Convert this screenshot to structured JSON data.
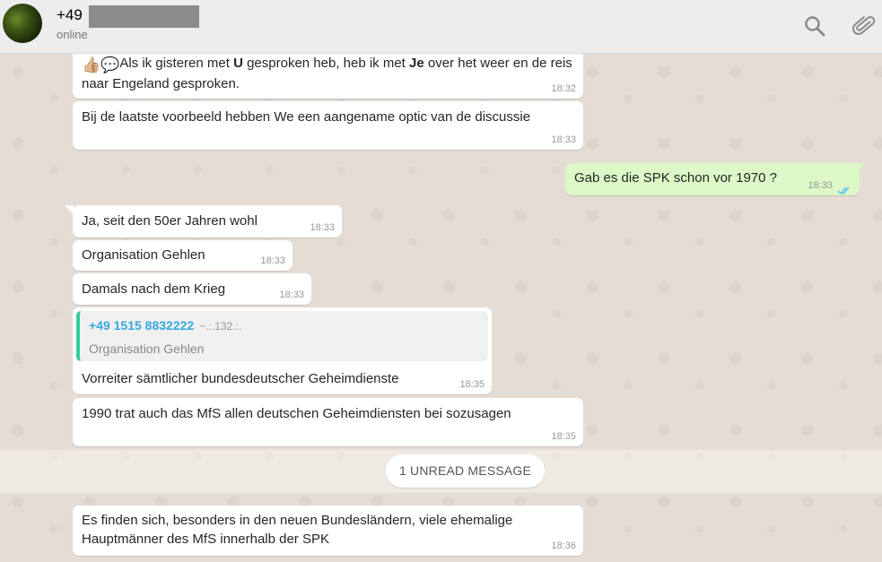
{
  "header": {
    "contact_name": "+49",
    "status": "online",
    "search_icon": "search-icon",
    "attach_icon": "paperclip-icon"
  },
  "messages": [
    {
      "dir": "in",
      "emoji": "👍🏼💬",
      "text": "Als ik gisteren met U gesproken heb, heb ik met Je over het weer en de reis naar Engeland gesproken.",
      "time": "18:32"
    },
    {
      "dir": "in",
      "text": "Bij de laatste voorbeeld hebben We een aangename optic van de discussie",
      "time": "18:33"
    },
    {
      "dir": "out",
      "text": "Gab es die SPK schon vor 1970 ?",
      "time": "18:33",
      "status": "read"
    },
    {
      "dir": "in",
      "text": "Ja, seit den 50er Jahren wohl",
      "time": "18:33"
    },
    {
      "dir": "in",
      "text": "Organisation Gehlen",
      "time": "18:33"
    },
    {
      "dir": "in",
      "text": "Damals nach dem Krieg",
      "time": "18:33"
    },
    {
      "dir": "in",
      "quote": {
        "sender": "+49 1515 8832222",
        "extra": "~.:.132.:.",
        "text": "Organisation Gehlen"
      },
      "text": "Vorreiter sämtlicher bundesdeutscher Geheimdienste",
      "time": "18:35"
    },
    {
      "dir": "in",
      "text": "1990 trat auch das MfS allen deutschen Geheimdiensten bei sozusagen",
      "time": "18:35"
    },
    {
      "dir": "in",
      "text": "Es finden sich, besonders in den neuen Bundesländern, viele ehemalige Hauptmänner des MfS innerhalb der SPK",
      "time": "18:36"
    }
  ],
  "unread_label": "1 UNREAD MESSAGE",
  "colors": {
    "outgoing": "#dcf8c6",
    "incoming": "#ffffff",
    "read_ticks": "#4fc3f7",
    "quote_bar": "#35cd96"
  }
}
